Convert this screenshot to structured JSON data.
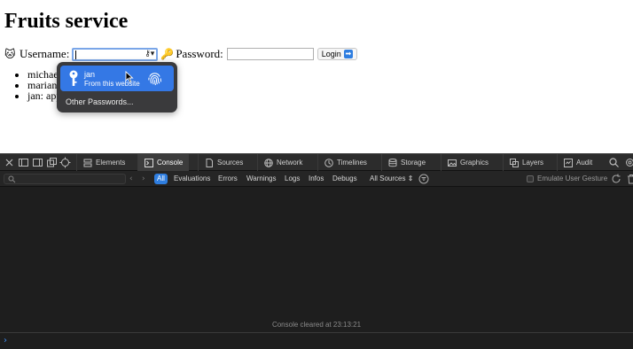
{
  "page": {
    "title": "Fruits service",
    "username_label": "Username:",
    "username_value": "",
    "password_label": "Password:",
    "password_value": "",
    "login_label": "Login",
    "user_emoji": "🐱",
    "key_emoji": "🔑",
    "users": [
      "michael",
      "marian:",
      "jan: app"
    ]
  },
  "autofill": {
    "username": "jan",
    "subtitle": "From this website",
    "other": "Other Passwords..."
  },
  "inspector": {
    "tabs": [
      "Elements",
      "Console",
      "Sources",
      "Network",
      "Timelines",
      "Storage",
      "Graphics",
      "Layers",
      "Audit"
    ],
    "active_tab": "Console",
    "levels": [
      "All",
      "Evaluations",
      "Errors",
      "Warnings",
      "Logs",
      "Infos",
      "Debugs"
    ],
    "sources_label": "All Sources",
    "emulate_label": "Emulate User Gesture",
    "cleared_message": "Console cleared at 23:13:21",
    "prompt": "›"
  },
  "colors": {
    "accent": "#2f7ee0",
    "autofill_bg": "#3a3a3c",
    "autofill_selected": "#3478e5",
    "inspector_bg": "#1e1e1e"
  }
}
